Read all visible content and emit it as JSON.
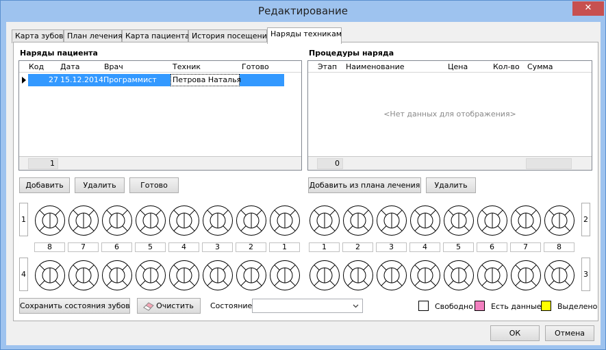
{
  "window": {
    "title": "Редактирование",
    "close": "✕"
  },
  "tabs": [
    "Карта зубов",
    "План лечения",
    "Карта пациента",
    "История посещений",
    "Наряды техникам"
  ],
  "orders": {
    "title": "Наряды пациента",
    "columns": [
      "Код",
      "Дата",
      "Врач",
      "Техник",
      "Готово"
    ],
    "rows": [
      {
        "code": "27",
        "date": "15.12.2014",
        "doctor": "Программист",
        "tech": "Петрова Наталья",
        "ready": ""
      }
    ],
    "footer_count": "1"
  },
  "procedures": {
    "title": "Процедуры наряда",
    "columns": [
      "Этап",
      "Наименование",
      "Цена",
      "Кол-во",
      "Сумма"
    ],
    "empty": "<Нет данных для отображения>",
    "footer_count": "0"
  },
  "buttons": {
    "add": "Добавить",
    "delete": "Удалить",
    "done": "Готово",
    "add_from_plan": "Добавить из плана лечения",
    "delete2": "Удалить",
    "save_teeth": "Сохранить состояния зубов",
    "clear": "Очистить",
    "ok": "ОК",
    "cancel": "Отмена"
  },
  "quadrants": [
    "1",
    "2",
    "4",
    "3"
  ],
  "tooth_numbers_left": [
    "8",
    "7",
    "6",
    "5",
    "4",
    "3",
    "2",
    "1"
  ],
  "tooth_numbers_right": [
    "1",
    "2",
    "3",
    "4",
    "5",
    "6",
    "7",
    "8"
  ],
  "state_label": "Состояние",
  "state_value": "",
  "legend": [
    {
      "label": "Свободно",
      "color": "#ffffff"
    },
    {
      "label": "Есть данные",
      "color": "#f27fbf"
    },
    {
      "label": "Выделено",
      "color": "#ffff00"
    }
  ]
}
